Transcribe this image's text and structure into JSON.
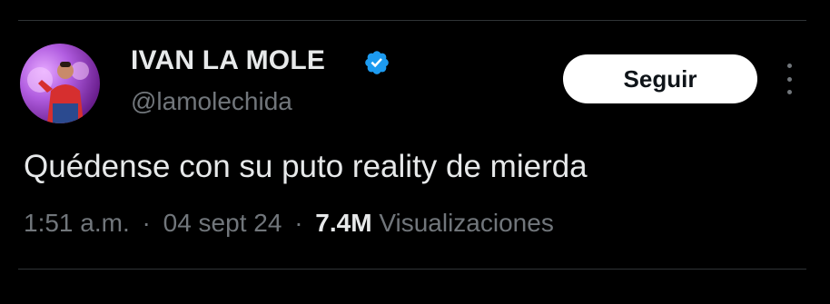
{
  "tweet": {
    "author": {
      "display_name": "IVAN LA MOLE",
      "handle": "@lamolechida",
      "verified": true,
      "avatar_icon": "profile-photo"
    },
    "follow_label": "Seguir",
    "more_icon": "more-vertical-icon",
    "text": "Quédense con su puto reality de mierda",
    "meta": {
      "time": "1:51 a.m.",
      "separator": "·",
      "date": "04 sept 24",
      "views_count": "7.4M",
      "views_label": "Visualizaciones"
    }
  },
  "colors": {
    "background": "#000000",
    "primary_text": "#e7e9ea",
    "secondary_text": "#71767b",
    "verified_badge": "#1d9bf0",
    "button_bg": "#ffffff",
    "button_text": "#0f1419",
    "divider": "#2f3336"
  }
}
